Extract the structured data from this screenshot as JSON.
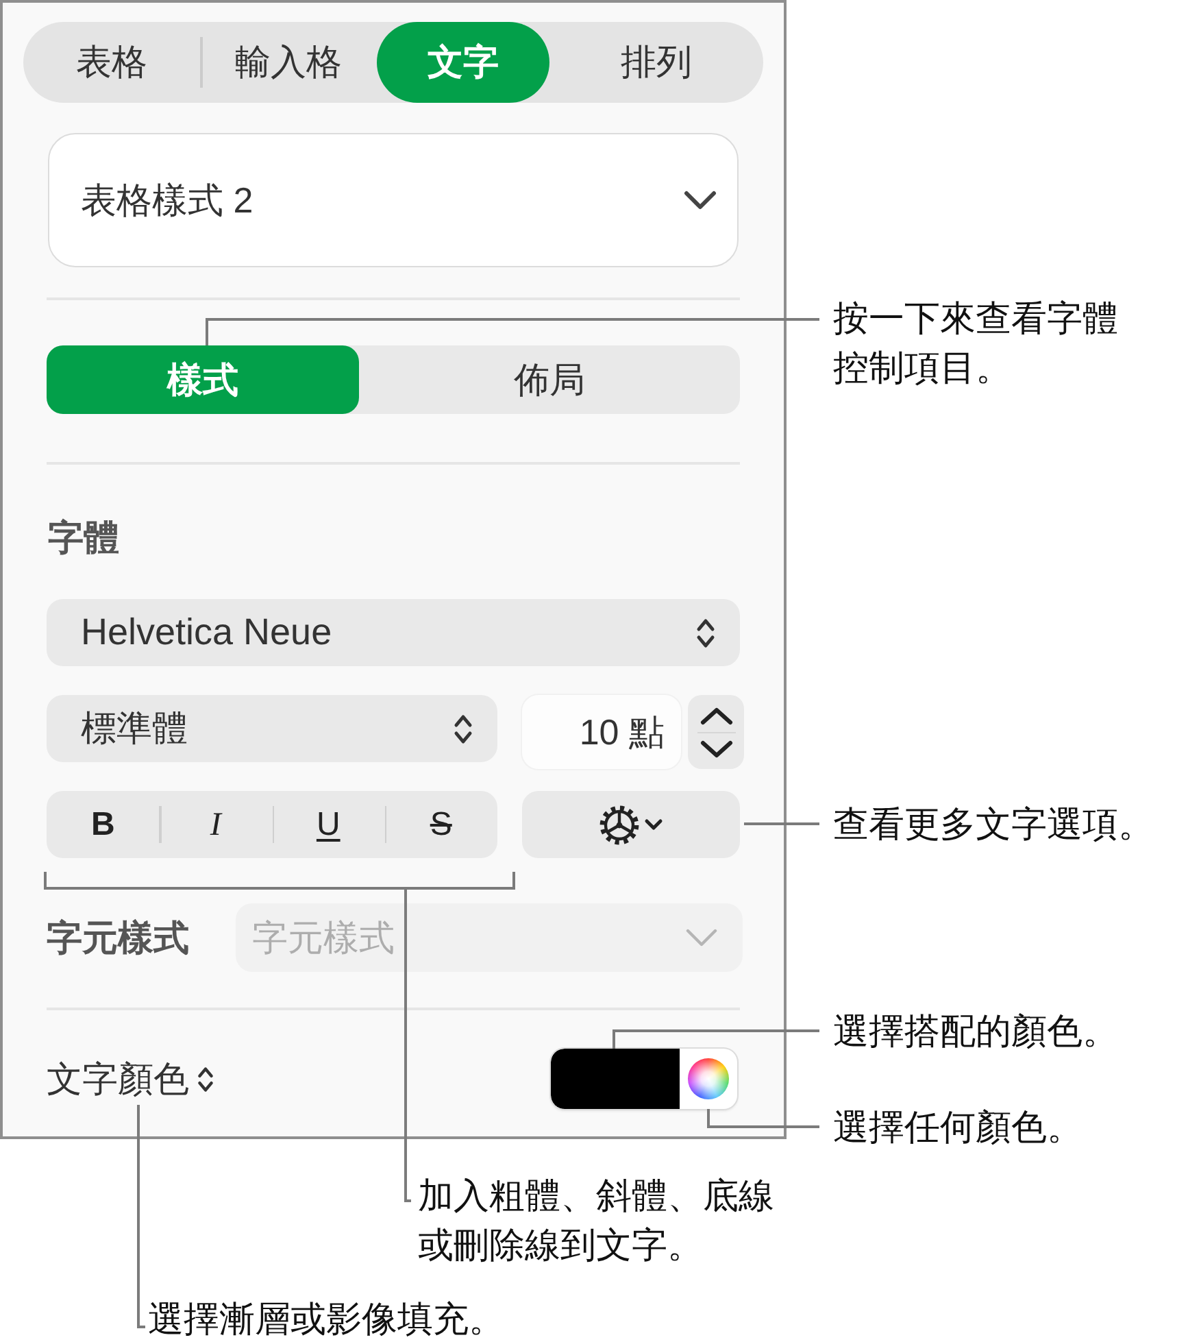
{
  "tabs": [
    {
      "label": "表格",
      "selected": false
    },
    {
      "label": "輸入格",
      "selected": false
    },
    {
      "label": "文字",
      "selected": true
    },
    {
      "label": "排列",
      "selected": false
    }
  ],
  "style_dropdown": {
    "value": "表格樣式 2"
  },
  "segments": [
    {
      "label": "樣式",
      "selected": true
    },
    {
      "label": "佈局",
      "selected": false
    }
  ],
  "font_section": {
    "title": "字體",
    "family": {
      "value": "Helvetica Neue"
    },
    "typeface": {
      "value": "標準體"
    },
    "size": {
      "value": "10 點"
    },
    "format_buttons": [
      {
        "kind": "bold",
        "label": "B"
      },
      {
        "kind": "italic",
        "label": "I"
      },
      {
        "kind": "underline",
        "label": "U"
      },
      {
        "kind": "strikethrough",
        "label": "S"
      }
    ]
  },
  "character_style": {
    "label": "字元樣式",
    "value": "字元樣式",
    "disabled": true
  },
  "text_color": {
    "label": "文字顏色",
    "color": "#000000"
  },
  "callouts": {
    "style_tab": "按一下來查看字體控制項目。",
    "more_options": "查看更多文字選項。",
    "matching_color": "選擇搭配的顏色。",
    "any_color": "選擇任何顏色。",
    "format_buttons": "加入粗體、斜體、底線或刪除線到文字。",
    "gradient_fill": "選擇漸層或影像填充。"
  }
}
